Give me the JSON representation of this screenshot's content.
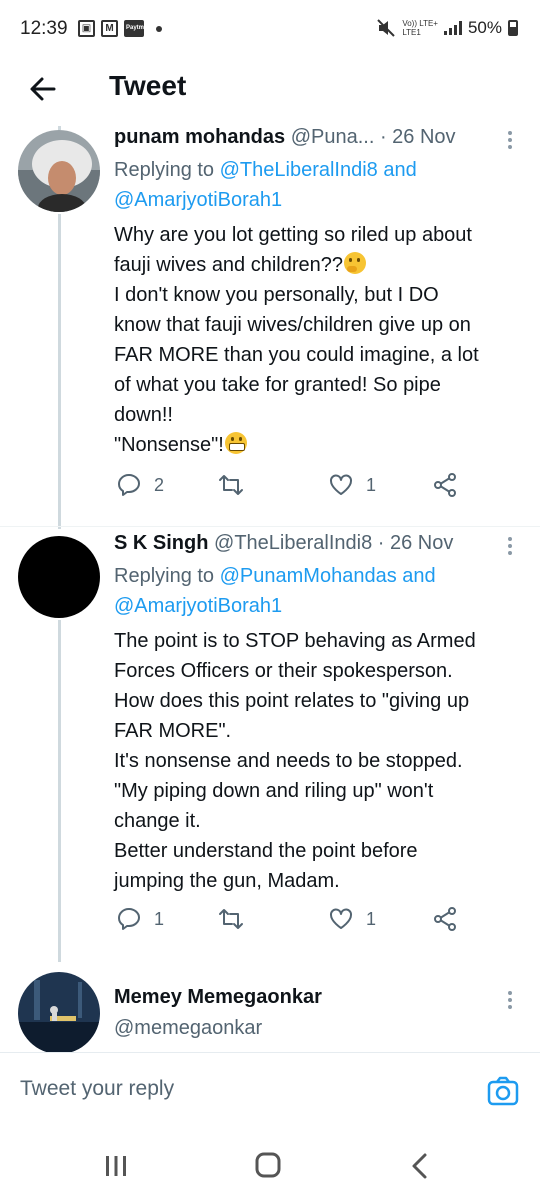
{
  "status_bar": {
    "time": "12:39",
    "paytm": "Paytm",
    "volte": "Vo)) LTE+",
    "lte1": "LTE1",
    "battery": "50%"
  },
  "header": {
    "title": "Tweet"
  },
  "tweets": [
    {
      "name": "punam mohandas",
      "handle": "@Puna...",
      "date": "· 26 Nov",
      "replying_prefix": "Replying to",
      "replying_1": "@TheLiberalIndi8",
      "replying_and": "and",
      "replying_2": "@AmarjyotiBorah1",
      "lines": [
        "Why are you lot getting so riled up about",
        "fauji wives and children??",
        "I don't know you personally, but I DO",
        "know that fauji wives/children give up on",
        "FAR MORE than you could imagine, a lot",
        "of what you take for granted! So pipe",
        "down!!",
        "\"Nonsense\"!"
      ],
      "replies": "2",
      "likes": "1"
    },
    {
      "name": "S K Singh",
      "handle": "@TheLiberalIndi8",
      "date": "· 26 Nov",
      "replying_prefix": "Replying to",
      "replying_1": "@PunamMohandas",
      "replying_and": "and",
      "replying_2": "@AmarjyotiBorah1",
      "lines": [
        "The point is to STOP behaving as Armed",
        "Forces Officers or their spokesperson.",
        "How does this point relates to \"giving up",
        "FAR MORE\".",
        "It's nonsense and needs to be stopped.",
        "\"My piping down and riling up\" won't",
        "change it.",
        "Better understand the point before",
        "jumping the gun, Madam."
      ],
      "replies": "1",
      "likes": "1"
    },
    {
      "name": "Memey Memegaonkar",
      "handle": "@memegaonkar"
    }
  ],
  "reply_bar": {
    "placeholder": "Tweet your reply"
  },
  "colors": {
    "link": "#1d9bf0",
    "muted": "#536471",
    "text": "#0f1419"
  }
}
